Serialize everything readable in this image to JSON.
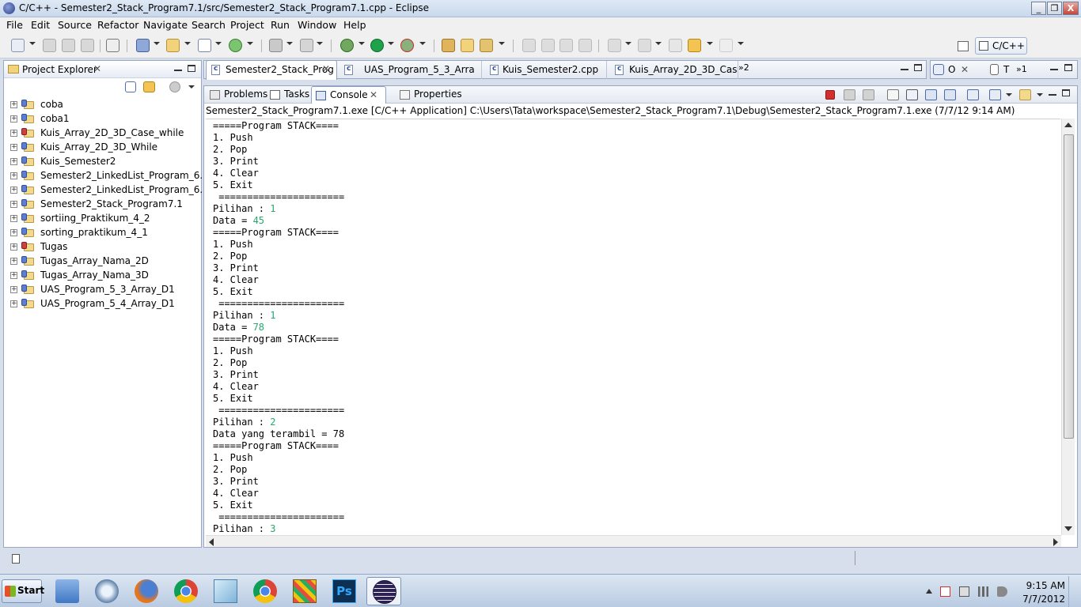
{
  "window": {
    "title": "C/C++ - Semester2_Stack_Program7.1/src/Semester2_Stack_Program7.1.cpp - Eclipse",
    "minimize": "_",
    "restore": "❐",
    "close": "X"
  },
  "menu": [
    "File",
    "Edit",
    "Source",
    "Refactor",
    "Navigate",
    "Search",
    "Project",
    "Run",
    "Window",
    "Help"
  ],
  "perspective": {
    "label": "C/C++"
  },
  "explorer": {
    "title": "Project Explorer",
    "projects": [
      {
        "name": "coba",
        "error": false
      },
      {
        "name": "coba1",
        "error": false
      },
      {
        "name": "Kuis_Array_2D_3D_Case_while",
        "error": true
      },
      {
        "name": "Kuis_Array_2D_3D_While",
        "error": false
      },
      {
        "name": "Kuis_Semester2",
        "error": false
      },
      {
        "name": "Semester2_LinkedList_Program_6.1",
        "error": false
      },
      {
        "name": "Semester2_LinkedList_Program_6.2",
        "error": false
      },
      {
        "name": "Semester2_Stack_Program7.1",
        "error": false
      },
      {
        "name": "sortiing_Praktikum_4_2",
        "error": false
      },
      {
        "name": "sorting_praktikum_4_1",
        "error": false
      },
      {
        "name": "Tugas",
        "error": true
      },
      {
        "name": "Tugas_Array_Nama_2D",
        "error": false
      },
      {
        "name": "Tugas_Array_Nama_3D",
        "error": false
      },
      {
        "name": "UAS_Program_5_3_Array_D1",
        "error": false
      },
      {
        "name": "UAS_Program_5_4_Array_D1",
        "error": false
      }
    ]
  },
  "editor_tabs": [
    {
      "label": "Semester2_Stack_Prog",
      "active": true
    },
    {
      "label": "UAS_Program_5_3_Arra",
      "active": false
    },
    {
      "label": "Kuis_Semester2.cpp",
      "active": false
    },
    {
      "label": "Kuis_Array_2D_3D_Cas",
      "active": false
    }
  ],
  "more_tabs": "»2",
  "outline": {
    "o": "O",
    "t": "T",
    "more": "»1"
  },
  "views": {
    "tabs": [
      {
        "label": "Problems",
        "active": false
      },
      {
        "label": "Tasks",
        "active": false
      },
      {
        "label": "Console",
        "active": true
      },
      {
        "label": "Properties",
        "active": false
      }
    ]
  },
  "console": {
    "description": "Semester2_Stack_Program7.1.exe [C/C++ Application] C:\\Users\\Tata\\workspace\\Semester2_Stack_Program7.1\\Debug\\Semester2_Stack_Program7.1.exe (7/7/12 9:14 AM)",
    "lines": [
      {
        "text": "=====Program STACK===="
      },
      {
        "text": "1. Push"
      },
      {
        "text": "2. Pop"
      },
      {
        "text": "3. Print"
      },
      {
        "text": "4. Clear"
      },
      {
        "text": "5. Exit"
      },
      {
        "text": " ======================"
      },
      {
        "text": "Pilihan : ",
        "input": "1"
      },
      {
        "text": "Data = ",
        "input": "45"
      },
      {
        "text": "=====Program STACK===="
      },
      {
        "text": "1. Push"
      },
      {
        "text": "2. Pop"
      },
      {
        "text": "3. Print"
      },
      {
        "text": "4. Clear"
      },
      {
        "text": "5. Exit"
      },
      {
        "text": " ======================"
      },
      {
        "text": "Pilihan : ",
        "input": "1"
      },
      {
        "text": "Data = ",
        "input": "78"
      },
      {
        "text": "=====Program STACK===="
      },
      {
        "text": "1. Push"
      },
      {
        "text": "2. Pop"
      },
      {
        "text": "3. Print"
      },
      {
        "text": "4. Clear"
      },
      {
        "text": "5. Exit"
      },
      {
        "text": " ======================"
      },
      {
        "text": "Pilihan : ",
        "input": "2"
      },
      {
        "text": "Data yang terambil = 78"
      },
      {
        "text": "=====Program STACK===="
      },
      {
        "text": "1. Push"
      },
      {
        "text": "2. Pop"
      },
      {
        "text": "3. Print"
      },
      {
        "text": "4. Clear"
      },
      {
        "text": "5. Exit"
      },
      {
        "text": " ======================"
      },
      {
        "text": "Pilihan : ",
        "input": "3"
      }
    ],
    "input_color": "#27a86b"
  },
  "taskbar": {
    "start_label": "Start",
    "apps": [
      "explorer",
      "itunes",
      "firefox",
      "chrome",
      "notepad",
      "chrome",
      "game",
      "photoshop",
      "eclipse"
    ],
    "active_app": "eclipse",
    "photoshop_label": "Ps",
    "clock_time": "9:15 AM",
    "clock_date": "7/7/2012"
  }
}
